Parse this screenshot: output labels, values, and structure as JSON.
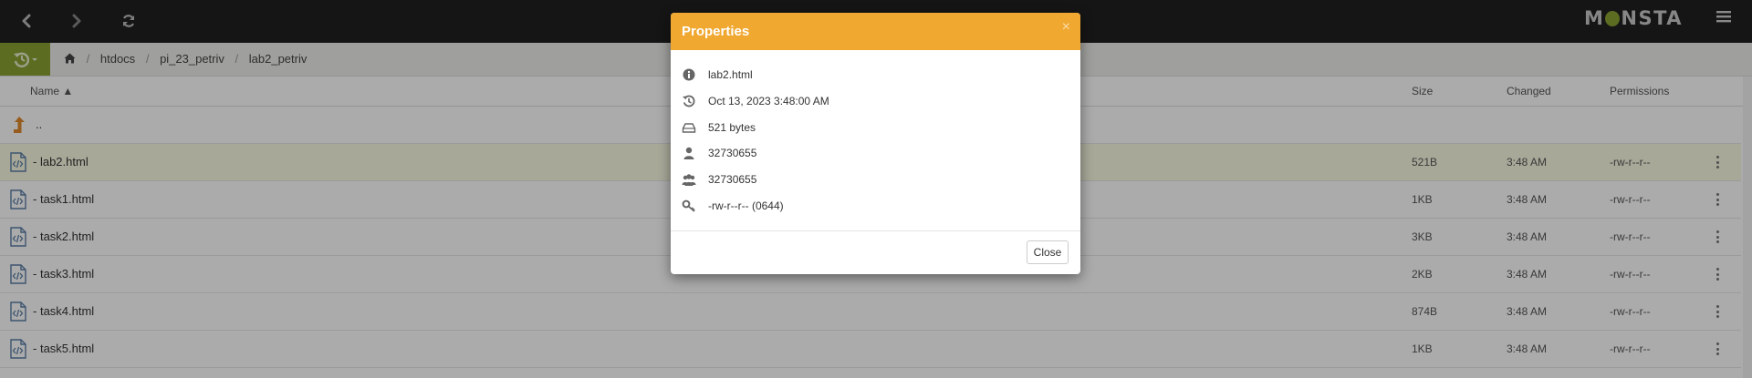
{
  "app": {
    "logo": "MONSTA"
  },
  "toolbar": {
    "back_icon": "chevron-left-icon",
    "forward_icon": "chevron-right-icon",
    "refresh_icon": "refresh-icon",
    "menu_icon": "hamburger-icon"
  },
  "breadcrumb": {
    "home_icon": "home-icon",
    "items": [
      "htdocs",
      "pi_23_petriv",
      "lab2_petriv"
    ],
    "separator": "/"
  },
  "columns": {
    "name": "Name ▲",
    "size": "Size",
    "changed": "Changed",
    "permissions": "Permissions"
  },
  "files": {
    "parent": "..",
    "rows": [
      {
        "name": "lab2.html",
        "size": "521B",
        "changed": "3:48 AM",
        "permissions": "-rw-r--r--",
        "selected": true
      },
      {
        "name": "task1.html",
        "size": "1KB",
        "changed": "3:48 AM",
        "permissions": "-rw-r--r--"
      },
      {
        "name": "task2.html",
        "size": "3KB",
        "changed": "3:48 AM",
        "permissions": "-rw-r--r--"
      },
      {
        "name": "task3.html",
        "size": "2KB",
        "changed": "3:48 AM",
        "permissions": "-rw-r--r--"
      },
      {
        "name": "task4.html",
        "size": "874B",
        "changed": "3:48 AM",
        "permissions": "-rw-r--r--"
      },
      {
        "name": "task5.html",
        "size": "1KB",
        "changed": "3:48 AM",
        "permissions": "-rw-r--r--"
      }
    ]
  },
  "dialog": {
    "title": "Properties",
    "close_x": "×",
    "properties": [
      {
        "icon": "info-icon",
        "value": "lab2.html"
      },
      {
        "icon": "history-icon",
        "value": "Oct 13, 2023 3:48:00 AM"
      },
      {
        "icon": "hard-drive-icon",
        "value": "521 bytes"
      },
      {
        "icon": "user-icon",
        "value": "32730655"
      },
      {
        "icon": "users-icon",
        "value": "32730655"
      },
      {
        "icon": "key-icon",
        "value": "-rw-r--r-- (0644)"
      }
    ],
    "close_button": "Close"
  },
  "colors": {
    "topbar": "#202020",
    "accent_green": "#8aa132",
    "dialog_header": "#f0a830",
    "selected_row": "#fbfbe4"
  }
}
